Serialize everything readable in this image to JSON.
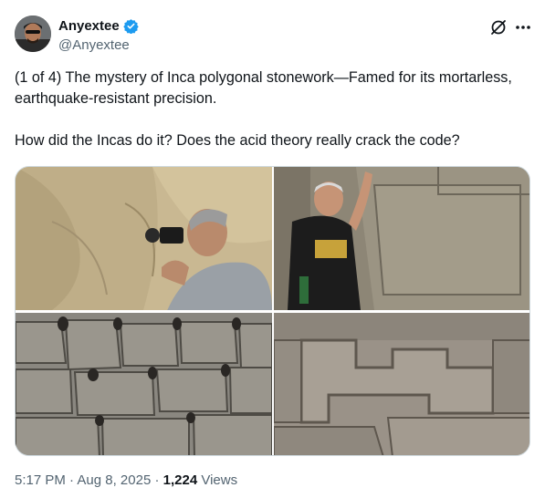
{
  "author": {
    "display_name": "Anyextee",
    "handle": "@Anyextee",
    "verified_color": "#1d9bf0"
  },
  "tweet": {
    "text": "(1 of 4) The mystery of Inca polygonal stonework—Famed for its mortarless, earthquake-resistant precision.\n\nHow did the Incas do it? Does the acid theory really crack the code?"
  },
  "media": {
    "count": 4,
    "items": [
      "photo-man-with-camera-at-stone-wall",
      "photo-man-posing-at-stone-wall",
      "photo-polygonal-wall-with-shadows",
      "photo-stepped-stone-joint"
    ]
  },
  "meta": {
    "time": "5:17 PM",
    "separator": "·",
    "date": "Aug 8, 2025",
    "views_count": "1,224",
    "views_label": "Views"
  },
  "icons": {
    "grok": "grok-icon",
    "more": "more-options-icon",
    "verified": "verified-badge-icon"
  },
  "colors": {
    "text": "#0f1419",
    "secondary": "#536471",
    "border": "#cfd9de",
    "accent": "#1d9bf0"
  }
}
